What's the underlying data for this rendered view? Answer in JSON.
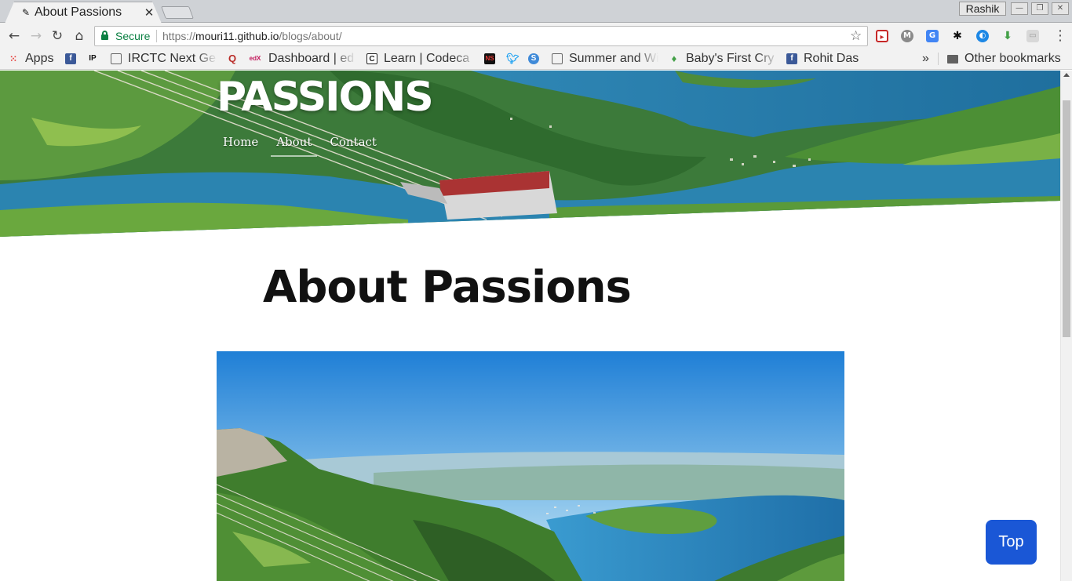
{
  "browser": {
    "tab": {
      "title": "About Passions"
    },
    "profile_name": "Rashik",
    "omnibox": {
      "secure_label": "Secure",
      "url_prefix": "https://",
      "url_host": "mouri11.github.io",
      "url_path": "/blogs/about/"
    }
  },
  "bookmarks": {
    "items": [
      {
        "label": "Apps",
        "icon": "apps-grid-icon"
      },
      {
        "label": "",
        "icon": "facebook-icon"
      },
      {
        "label": "",
        "icon": "ip-icon",
        "icon_text": "IP"
      },
      {
        "label": "IRCTC Next Ge",
        "icon": "page-icon"
      },
      {
        "label": "",
        "icon": "quora-icon",
        "icon_text": "Q"
      },
      {
        "label": "Dashboard | ed",
        "icon": "edx-icon",
        "icon_text": "edX"
      },
      {
        "label": "Learn | Codeca",
        "icon": "codecademy-icon",
        "icon_text": "C"
      },
      {
        "label": "",
        "icon": "ns-icon",
        "icon_text": "NS"
      },
      {
        "label": "",
        "icon": "twitter-icon"
      },
      {
        "label": "",
        "icon": "s-icon",
        "icon_text": "S"
      },
      {
        "label": "Summer and Wi",
        "icon": "page-icon"
      },
      {
        "label": "Baby's First Cry",
        "icon": "flame-icon"
      },
      {
        "label": "Rohit Das",
        "icon": "facebook-icon"
      }
    ],
    "overflow": "»",
    "other": "Other bookmarks"
  },
  "site": {
    "title": "PASSIONS",
    "nav": [
      "Home",
      "About",
      "Contact"
    ],
    "active_nav": "About"
  },
  "page": {
    "heading": "About Passions",
    "top_button": "Top"
  }
}
